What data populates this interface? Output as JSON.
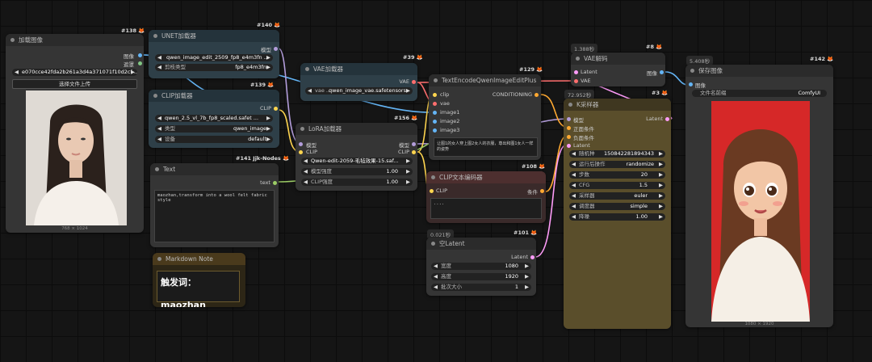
{
  "colors": {
    "image": "#64b5f6",
    "mask": "#81c784",
    "model": "#b39ddb",
    "clip": "#ffd54f",
    "vae": "#ff6e6e",
    "latent": "#ff9cf9",
    "conditioning": "#ffa931",
    "string": "#9ccc65"
  },
  "load_image": {
    "id": "#138",
    "title": "加载图像",
    "out_image": "图像",
    "out_mask": "遮罩",
    "file": "e070cce42fda2b261a3d4a371071f10d2cf ...",
    "upload": "选择文件上传",
    "size": "768 × 1024"
  },
  "unet": {
    "id": "#140",
    "title": "UNET加载器",
    "out_model": "模型",
    "unet_name": "qwen_image_edit_2509_fp8_e4m3fn ...",
    "dtype_label": "剪枝类型",
    "dtype": "fp8_e4m3fn"
  },
  "clip_loader": {
    "id": "#139",
    "title": "CLIP加载器",
    "out_clip": "CLIP",
    "clip_name": "qwen_2.5_vl_7b_fp8_scaled.safet ...",
    "type_label": "类型",
    "type": "qwen_image",
    "device_label": "设备",
    "device": "default"
  },
  "text_node": {
    "id": "#141 Jjk-Nodes",
    "title": "Text",
    "out_text": "text",
    "content": "maozhan,transform into a wool felt fabric style"
  },
  "markdown": {
    "title": "Markdown Note",
    "content": "触发词：maozhan"
  },
  "vae_loader": {
    "id": "#39",
    "title": "VAE加载器",
    "out_vae": "VAE",
    "vae_label": "vae ...",
    "vae_name": "qwen_image_vae.safetensors"
  },
  "lora": {
    "id": "#156",
    "title": "LoRA加载器",
    "in_model": "模型",
    "in_clip": "CLIP",
    "out_model": "模型",
    "out_clip": "CLIP",
    "lora_name": "Qwen-edit-2059-毛毡效果-15.saf...",
    "ms_label": "模型强度",
    "ms": "1.00",
    "cs_label": "CLIP强度",
    "cs": "1.00"
  },
  "text_encode": {
    "id": "#129",
    "title": "TextEncodeQwenImageEditPlus",
    "in_clip": "clip",
    "in_vae": "vae",
    "in_image1": "image1",
    "in_image2": "image2",
    "in_image3": "image3",
    "out_cond": "CONDITIONING",
    "prompt": "让图1的女人穿上图2女人的衣服，尊出和图1女人一样的姿势"
  },
  "clip_encode": {
    "id": "#108",
    "title": "CLIP文本编码器",
    "in_clip": "CLIP",
    "out_cond": "条件",
    "content": "...."
  },
  "empty_latent": {
    "id": "#101",
    "time": "0.021秒",
    "title": "空Latent",
    "out_latent": "Latent",
    "width_label": "宽度",
    "width": "1080",
    "height_label": "高度",
    "height": "1920",
    "batch_label": "批次大小",
    "batch": "1"
  },
  "vae_decode": {
    "id": "#8",
    "time": "1.388秒",
    "title": "VAE解码",
    "in_latent": "Latent",
    "in_vae": "VAE",
    "out_image": "图像"
  },
  "ksampler": {
    "id": "#3",
    "time": "72.952秒",
    "title": "K采样器",
    "in_model": "模型",
    "in_pos": "正面条件",
    "in_neg": "负面条件",
    "in_latent": "Latent",
    "out_latent": "Latent",
    "widgets": [
      {
        "label": "随机种",
        "value": "150842281894343"
      },
      {
        "label": "运行后操作",
        "value": "randomize"
      },
      {
        "label": "步数",
        "value": "20"
      },
      {
        "label": "CFG",
        "value": "1.5"
      },
      {
        "label": "采样器",
        "value": "euler"
      },
      {
        "label": "调度器",
        "value": "simple"
      },
      {
        "label": "降噪",
        "value": "1.00"
      }
    ]
  },
  "save_image": {
    "id": "#142",
    "time": "5.408秒",
    "title": "保存图像",
    "in_image": "图像",
    "prefix_label": "文件名前缀",
    "prefix": "ComfyUI",
    "size": "1080 × 1920"
  }
}
